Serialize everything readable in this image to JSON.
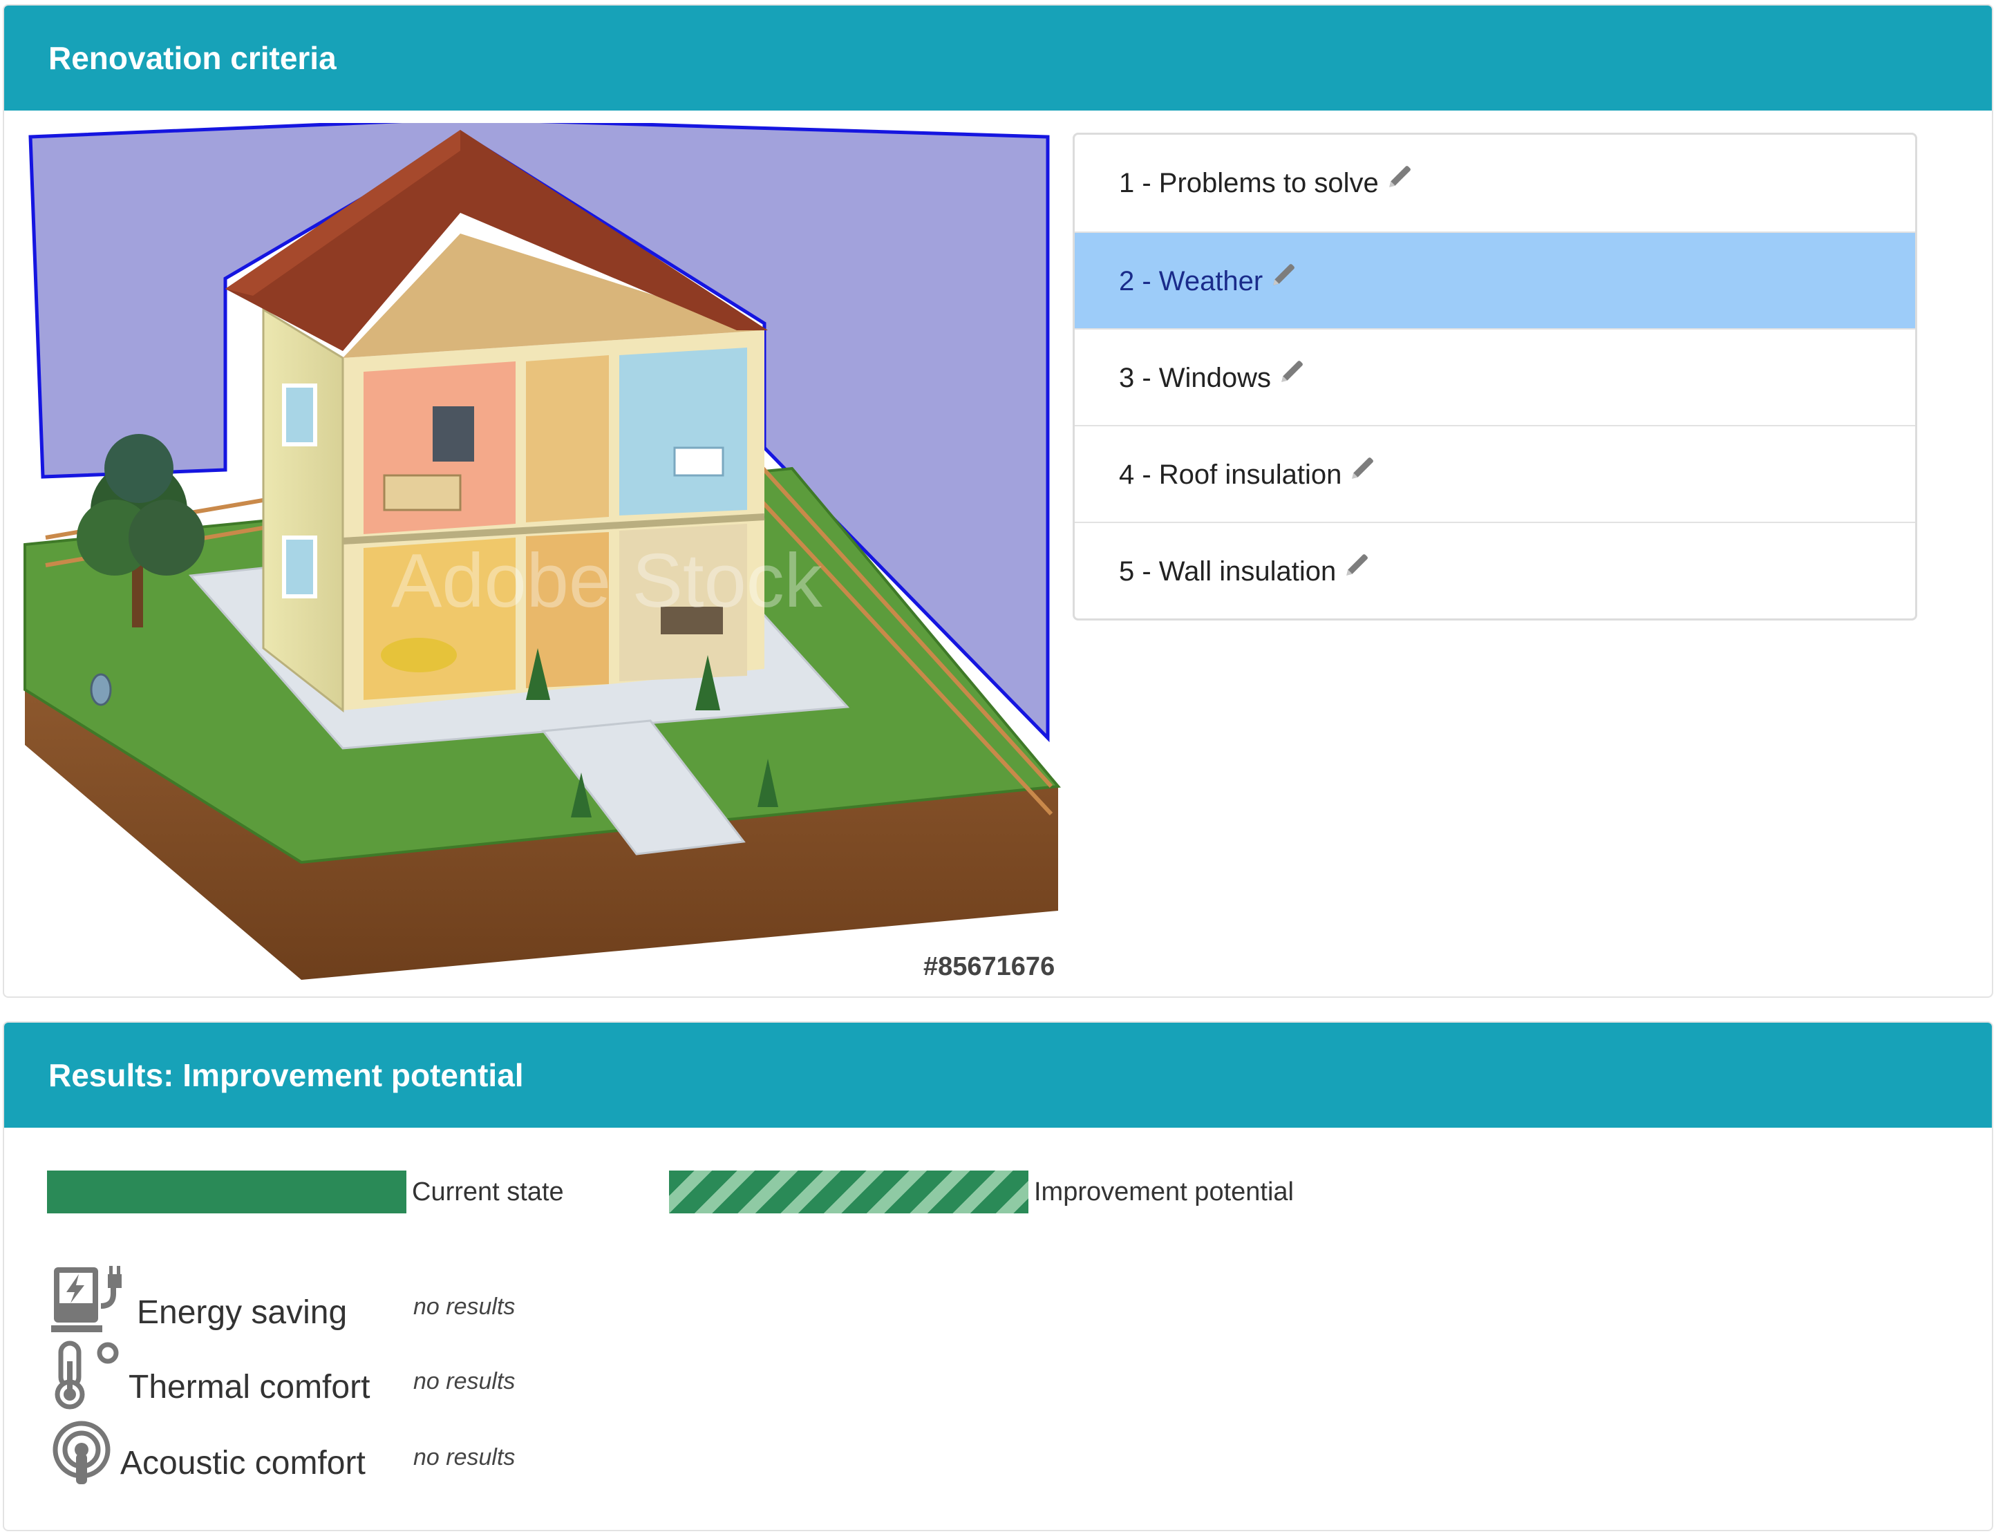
{
  "criteria_panel": {
    "title": "Renovation criteria",
    "image_id": "#85671676",
    "watermark": "Adobe Stock",
    "items": [
      {
        "number": "1",
        "label": "1 - Problems to solve",
        "active": false
      },
      {
        "number": "2",
        "label": "2 - Weather",
        "active": true
      },
      {
        "number": "3",
        "label": "3 - Windows",
        "active": false
      },
      {
        "number": "4",
        "label": "4 - Roof insulation",
        "active": false
      },
      {
        "number": "5",
        "label": "5 - Wall insulation",
        "active": false
      }
    ],
    "icons": {
      "edit": "pencil-icon"
    }
  },
  "results_panel": {
    "title": "Results: Improvement potential",
    "legend": {
      "current_label": "Current state",
      "improvement_label": "Improvement potential"
    },
    "metrics": [
      {
        "label": "Energy saving",
        "value": "no results",
        "icon": "energy-plug-icon"
      },
      {
        "label": "Thermal comfort",
        "value": "no results",
        "icon": "thermometer-icon"
      },
      {
        "label": "Acoustic comfort",
        "value": "no results",
        "icon": "acoustic-ear-icon"
      }
    ]
  },
  "colors": {
    "header": "#17a2b8",
    "active_item": "#9dccf9",
    "selection_fill": "#a2a2dc",
    "selection_stroke": "#1515e0",
    "current_state": "#2a8a57",
    "improvement": "#8fcaa4"
  }
}
